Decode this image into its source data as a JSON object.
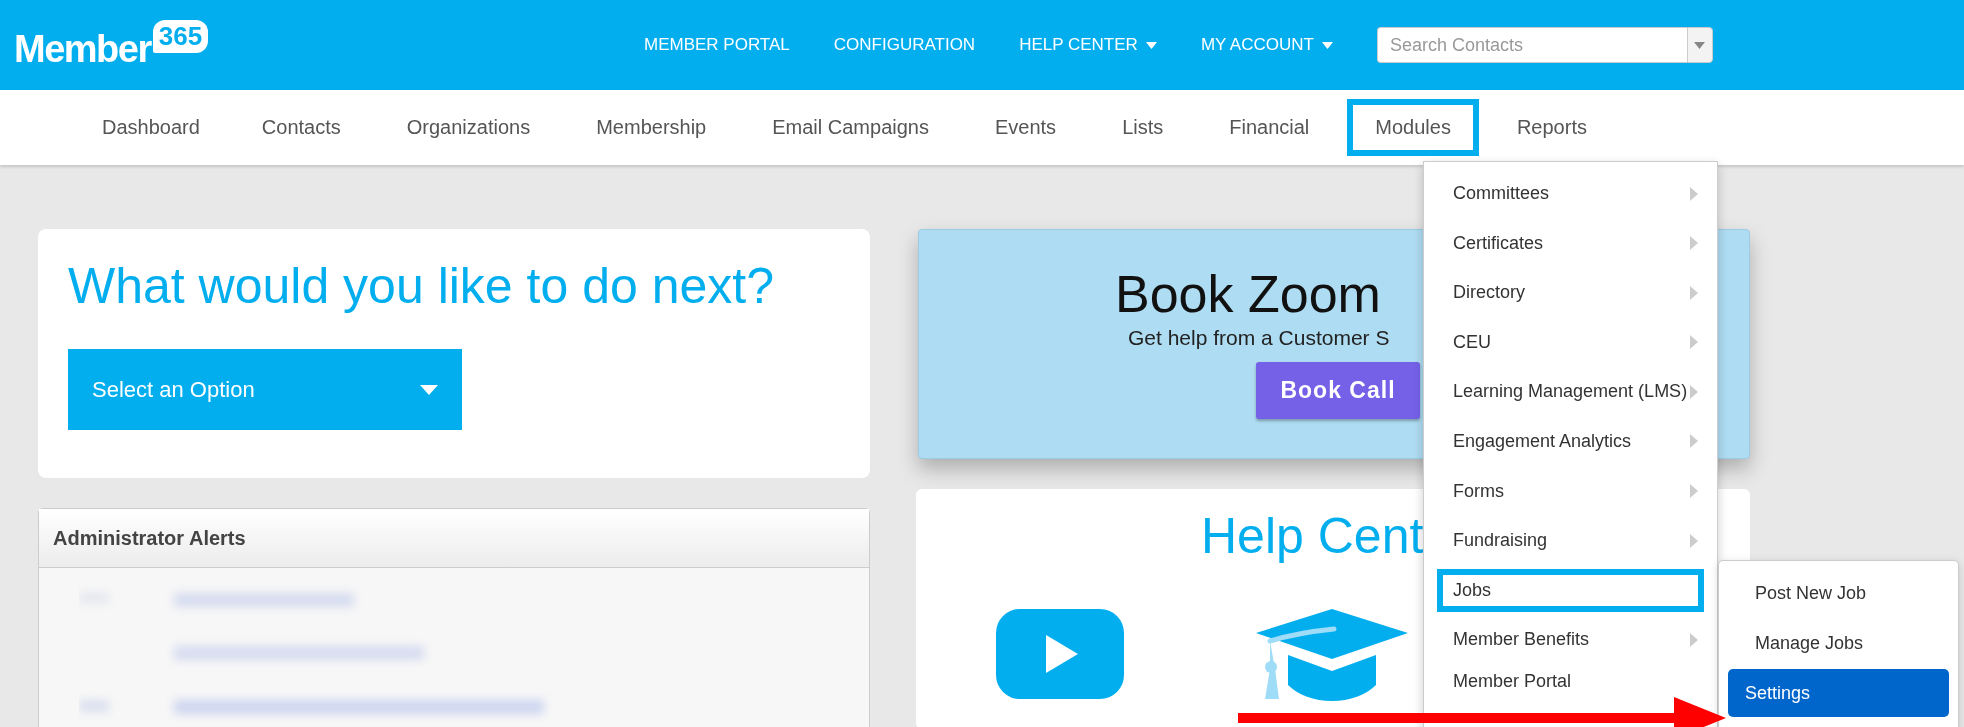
{
  "logo": {
    "name": "Member",
    "badge": "365"
  },
  "top_nav": [
    {
      "label": "MEMBER PORTAL",
      "dropdown": false
    },
    {
      "label": "CONFIGURATION",
      "dropdown": false
    },
    {
      "label": "HELP CENTER",
      "dropdown": true
    },
    {
      "label": "MY ACCOUNT",
      "dropdown": true
    }
  ],
  "search": {
    "placeholder": "Search Contacts"
  },
  "main_nav": [
    {
      "label": "Dashboard",
      "highlighted": false
    },
    {
      "label": "Contacts",
      "highlighted": false
    },
    {
      "label": "Organizations",
      "highlighted": false
    },
    {
      "label": "Membership",
      "highlighted": false
    },
    {
      "label": "Email Campaigns",
      "highlighted": false
    },
    {
      "label": "Events",
      "highlighted": false
    },
    {
      "label": "Lists",
      "highlighted": false
    },
    {
      "label": "Financial",
      "highlighted": false
    },
    {
      "label": "Modules",
      "highlighted": true
    },
    {
      "label": "Reports",
      "highlighted": false
    }
  ],
  "next_card": {
    "title": "What would you like to do next?",
    "select": "Select an Option"
  },
  "alerts": {
    "title": "Administrator Alerts"
  },
  "zoom_card": {
    "title": "Book Zoom",
    "subtitle": "Get help from a Customer S",
    "button": "Book Call"
  },
  "help_card": {
    "title": "Help Cent"
  },
  "modules_menu": [
    {
      "label": "Committees",
      "submenu": true,
      "highlighted": false
    },
    {
      "label": "Certificates",
      "submenu": true,
      "highlighted": false
    },
    {
      "label": "Directory",
      "submenu": true,
      "highlighted": false
    },
    {
      "label": "CEU",
      "submenu": true,
      "highlighted": false
    },
    {
      "label": "Learning Management (LMS)",
      "submenu": true,
      "highlighted": false
    },
    {
      "label": "Engagement Analytics",
      "submenu": true,
      "highlighted": false
    },
    {
      "label": "Forms",
      "submenu": true,
      "highlighted": false
    },
    {
      "label": "Fundraising",
      "submenu": true,
      "highlighted": false
    },
    {
      "label": "Jobs",
      "submenu": false,
      "highlighted": true
    },
    {
      "label": "Member Benefits",
      "submenu": true,
      "highlighted": false
    },
    {
      "label": "Member Portal",
      "submenu": false,
      "highlighted": false
    }
  ],
  "jobs_submenu": [
    {
      "label": "Post New Job",
      "selected": false
    },
    {
      "label": "Manage Jobs",
      "selected": false
    },
    {
      "label": "Settings",
      "selected": true
    }
  ]
}
